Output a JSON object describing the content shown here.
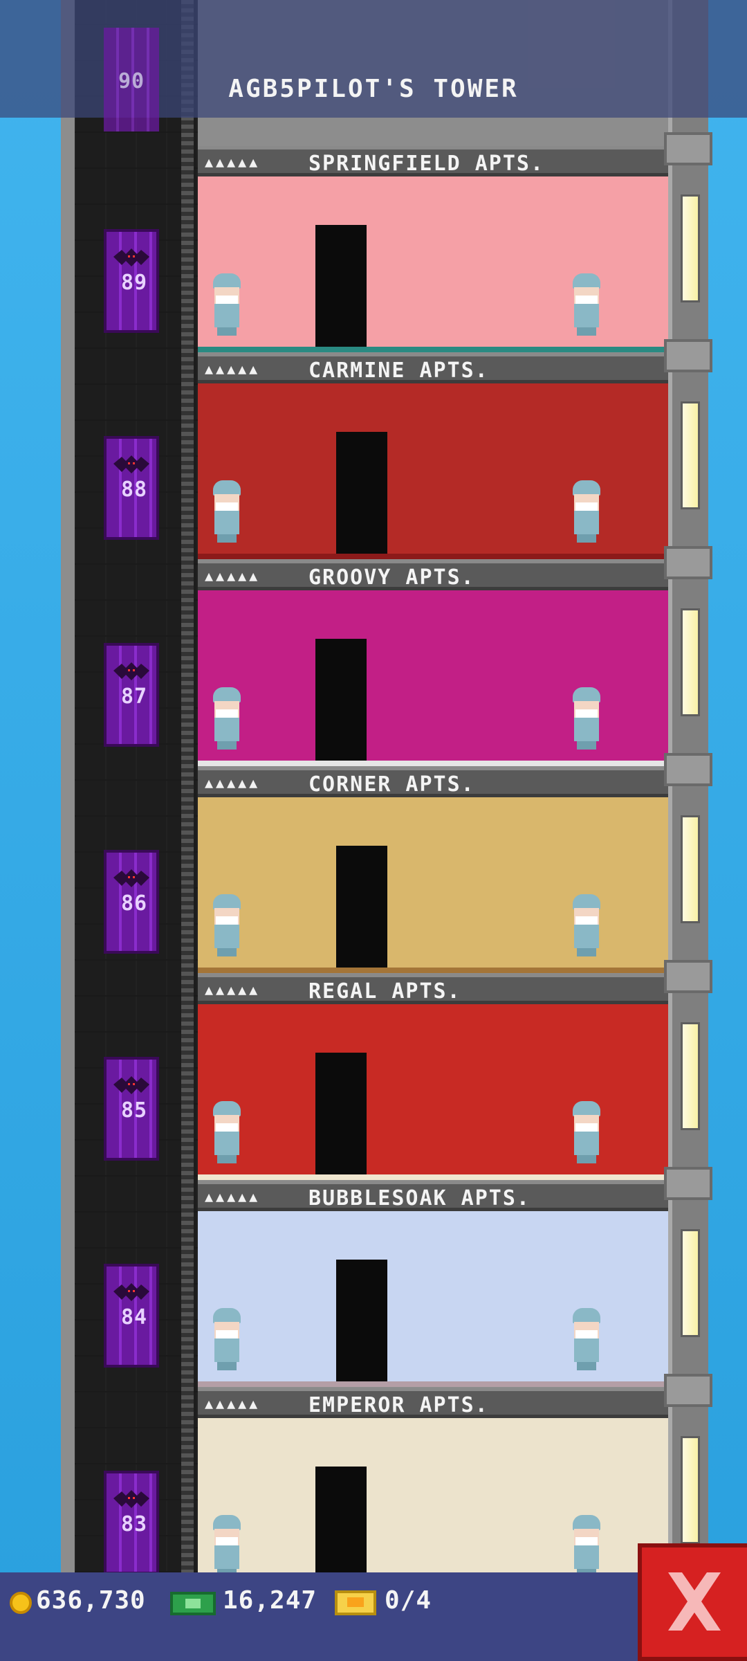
{
  "header": {
    "tower_title": "AGB5PILOT'S TOWER",
    "top_floor_number": "90"
  },
  "floors": [
    {
      "name": "SPRINGFIELD APTS.",
      "stars": "▲▲▲▲▲",
      "floor_number": "89",
      "wall": "#f5a0a6",
      "floor_color": "#2a8a82"
    },
    {
      "name": "CARMINE APTS.",
      "stars": "▲▲▲▲▲",
      "floor_number": "88",
      "wall": "#b42a26",
      "floor_color": "#8c1a1a"
    },
    {
      "name": "GROOVY APTS.",
      "stars": "▲▲▲▲▲",
      "floor_number": "87",
      "wall": "#c21f86",
      "floor_color": "#e6e6e6"
    },
    {
      "name": "CORNER APTS.",
      "stars": "▲▲▲▲▲",
      "floor_number": "86",
      "wall": "#d9b76c",
      "floor_color": "#a47538"
    },
    {
      "name": "REGAL APTS.",
      "stars": "▲▲▲▲▲",
      "floor_number": "85",
      "wall": "#c82a24",
      "floor_color": "#f0e6d0"
    },
    {
      "name": "BUBBLESOAK APTS.",
      "stars": "▲▲▲▲▲",
      "floor_number": "84",
      "wall": "#c8d6f2",
      "floor_color": "#b49ea6"
    },
    {
      "name": "EMPEROR APTS.",
      "stars": "▲▲▲▲▲",
      "floor_number": "83",
      "wall": "#ece3cc",
      "floor_color": "#2a2a2a"
    }
  ],
  "status_bar": {
    "coins": "636,730",
    "bux": "16,247",
    "tickets": "0/4"
  },
  "icons": {
    "coins": "coin-icon",
    "bux": "bux-icon",
    "tickets": "ticket-icon",
    "close": "close-icon"
  }
}
